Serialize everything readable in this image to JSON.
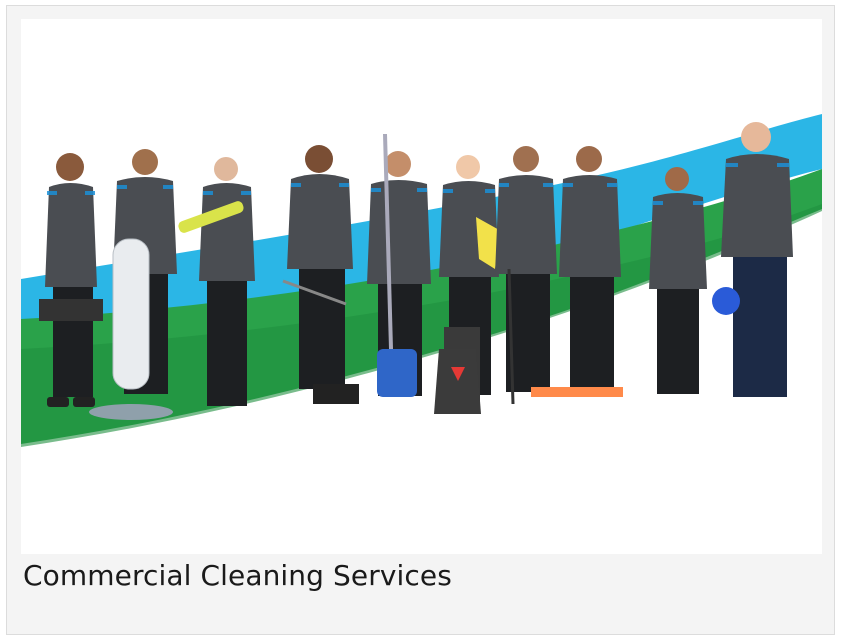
{
  "card": {
    "caption": "Commercial Cleaning Services"
  },
  "photo": {
    "subject": "team-of-cleaning-staff",
    "colors": {
      "uniform": "#4a4d52",
      "uniform_accent": "#1c8fd6",
      "swoosh_green": "#2aa24a",
      "swoosh_blue": "#2bb6e6",
      "pants": "#1d1f22"
    }
  }
}
